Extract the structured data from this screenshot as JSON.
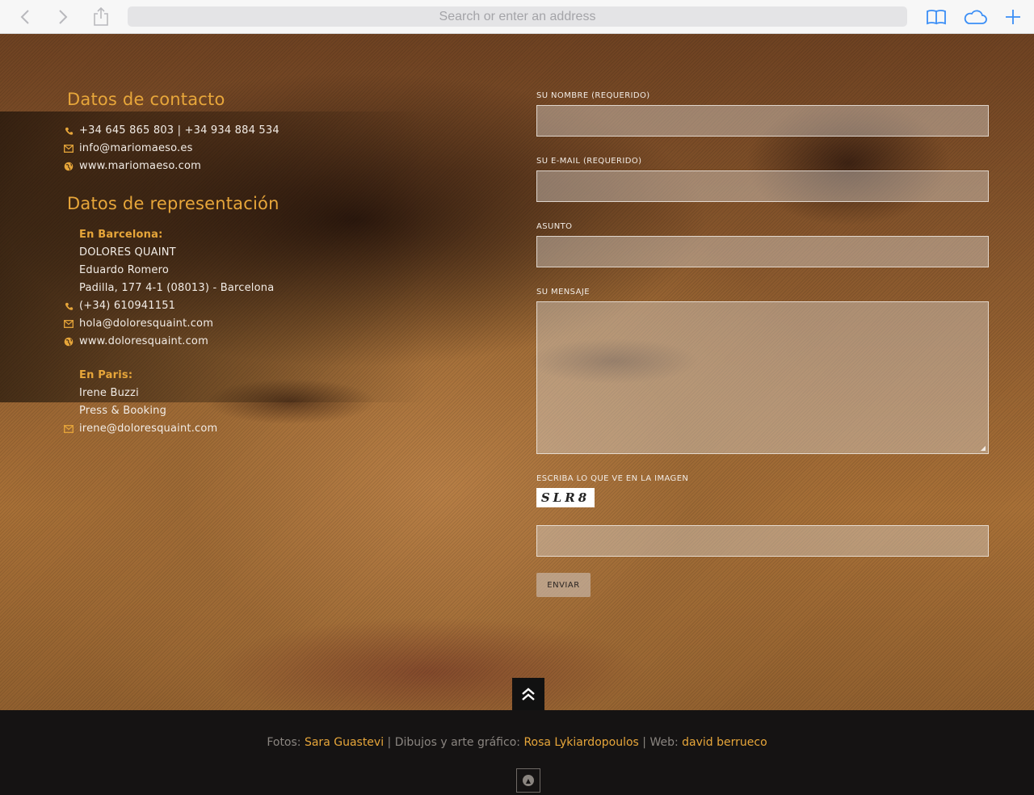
{
  "browser": {
    "address_placeholder": "Search or enter an address"
  },
  "contact": {
    "title": "Datos de contacto",
    "phone": "+34 645 865 803 | +34 934 884 534",
    "email": "info@mariomaeso.es",
    "web": "www.mariomaeso.com"
  },
  "representation": {
    "title": "Datos de representación",
    "barcelona": {
      "city": "En Barcelona:",
      "agency": "DOLORES QUAINT",
      "person": "Eduardo Romero",
      "address": "Padilla, 177 4-1 (08013) - Barcelona",
      "phone": "(+34) 610941151",
      "email": "hola@doloresquaint.com",
      "web": "www.doloresquaint.com"
    },
    "paris": {
      "city": "En Paris:",
      "person": "Irene Buzzi",
      "role": "Press & Booking",
      "email": "irene@doloresquaint.com"
    }
  },
  "form": {
    "name_label": "SU NOMBRE (REQUERIDO)",
    "email_label": "SU E-MAIL (REQUERIDO)",
    "subject_label": "ASUNTO",
    "message_label": "SU MENSAJE",
    "captcha_label": "ESCRIBA LO QUE VE EN LA IMAGEN",
    "captcha_text": "SLR8",
    "submit_label": "ENVIAR"
  },
  "footer": {
    "photos_prefix": "Fotos: ",
    "photos_author": "Sara Guastevi",
    "drawings_prefix": " | Dibujos y arte gráfico: ",
    "drawings_author": "Rosa Lykiardopoulos",
    "web_prefix": " | Web: ",
    "web_author": "david berrueco"
  },
  "colors": {
    "accent": "#e7a63a",
    "footer_bg": "#151313"
  }
}
